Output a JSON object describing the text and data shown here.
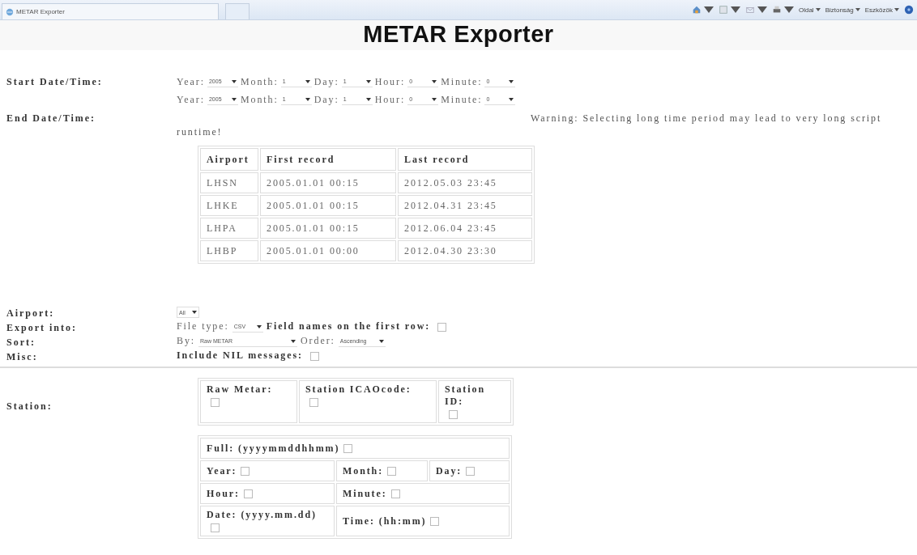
{
  "browser": {
    "tab_title": "METAR Exporter",
    "menus": [
      "Oldal",
      "Biztonság",
      "Eszközök"
    ]
  },
  "heading": "METAR Exporter",
  "start": {
    "label": "Start Date/Time:",
    "fields": [
      {
        "label": "Year:",
        "value": "2005"
      },
      {
        "label": "Month:",
        "value": "1"
      },
      {
        "label": "Day:",
        "value": "1"
      },
      {
        "label": "Hour:",
        "value": "0"
      },
      {
        "label": "Minute:",
        "value": "0"
      }
    ]
  },
  "end": {
    "label": "End Date/Time:",
    "fields": [
      {
        "label": "Year:",
        "value": "2005"
      },
      {
        "label": "Month:",
        "value": "1"
      },
      {
        "label": "Day:",
        "value": "1"
      },
      {
        "label": "Hour:",
        "value": "0"
      },
      {
        "label": "Minute:",
        "value": "0"
      }
    ],
    "warning": "Warning: Selecting long time period may lead to very long script runtime!"
  },
  "airports_table": {
    "columns": [
      "Airport",
      "First record",
      "Last record"
    ],
    "rows": [
      [
        "LHSN",
        "2005.01.01 00:15",
        "2012.05.03 23:45"
      ],
      [
        "LHKE",
        "2005.01.01 00:15",
        "2012.04.31 23:45"
      ],
      [
        "LHPA",
        "2005.01.01 00:15",
        "2012.06.04 23:45"
      ],
      [
        "LHBP",
        "2005.01.01 00:00",
        "2012.04.30 23:30"
      ]
    ]
  },
  "airport": {
    "label": "Airport:",
    "value": "All"
  },
  "export": {
    "label": "Export into:",
    "file_type_label": "File type:",
    "file_type": "CSV",
    "field_names_label": "Field names on the first row:",
    "field_names_checked": false
  },
  "sort": {
    "label": "Sort:",
    "by_label": "By:",
    "by": "Raw METAR",
    "order_label": "Order:",
    "order": "Ascending"
  },
  "misc": {
    "label": "Misc:",
    "nil_label": "Include NIL messages:",
    "nil_checked": false
  },
  "station": {
    "label": "Station:",
    "fields": [
      {
        "label": "Raw Metar:",
        "checked": false
      },
      {
        "label": "Station ICAOcode:",
        "checked": false
      },
      {
        "label": "Station ID:",
        "checked": false
      }
    ]
  },
  "datetime_fields": {
    "rows": [
      [
        {
          "label": "Full: (yyyymmddhhmm)",
          "checked": false,
          "colspan": 3
        }
      ],
      [
        {
          "label": "Year:",
          "checked": false
        },
        {
          "label": "Month:",
          "checked": false
        },
        {
          "label": "Day:",
          "checked": false
        }
      ],
      [
        {
          "label": "Hour:",
          "checked": false
        },
        {
          "label": "Minute:",
          "checked": false,
          "colspan": 2
        }
      ],
      [
        {
          "label": "Date: (yyyy.mm.dd)",
          "checked": false
        },
        {
          "label": "Time: (hh:mm)",
          "checked": false,
          "colspan": 2
        }
      ]
    ]
  }
}
